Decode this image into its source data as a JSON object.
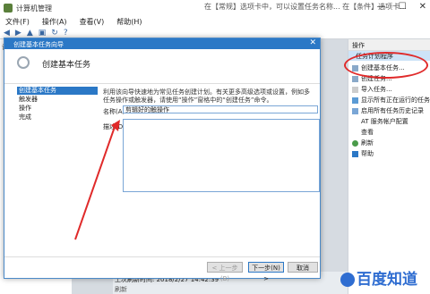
{
  "window": {
    "title": "计算机管理",
    "overlay_text": "在【常规】选项卡中，可以设置任务名称...  在【条件】选项卡..."
  },
  "menubar": [
    "文件(F)",
    "操作(A)",
    "查看(V)",
    "帮助(H)"
  ],
  "toolbar_icons": [
    "back-icon",
    "forward-icon",
    "up-icon",
    "folder-icon",
    "refresh-icon",
    "help-icon"
  ],
  "tree": [
    "计",
    "(",
    "(",
    "(",
    "(",
    "(",
    "(",
    "(",
    "(",
    "(",
    "(",
    "(",
    "(",
    "(",
    "(",
    "(",
    "(",
    "("
  ],
  "actions": {
    "header": "操作",
    "subheader": "任务计划程序",
    "items": [
      {
        "label": "创建基本任务...",
        "icon": "task-icon"
      },
      {
        "label": "创建任务...",
        "icon": "task-icon"
      },
      {
        "label": "导入任务...",
        "icon": "import-icon"
      },
      {
        "label": "显示所有正在运行的任务",
        "icon": "run-icon"
      },
      {
        "label": "启用所有任务历史记录",
        "icon": "history-icon"
      },
      {
        "label": "AT 服务帐户配置",
        "icon": "config-icon"
      },
      {
        "label": "查看",
        "icon": "view-icon"
      },
      {
        "label": "刷新",
        "icon": "refresh-icon"
      },
      {
        "label": "帮助",
        "icon": "help-icon"
      }
    ]
  },
  "status": {
    "last_run_label": "上次刷新时间: 2018/2/27 14:42:39",
    "refresh_label": "刷新"
  },
  "dialog": {
    "title": "创建基本任务向导",
    "heading": "创建基本任务",
    "steps": [
      "创建基本任务",
      "触发器",
      "操作",
      "完成"
    ],
    "description": "利用该向导快速地为常见任务创建计划。有关更多高级选项或设置，例如多任务操作或触发器，请使用“操作”窗格中的“创建任务”命令。",
    "name_label": "名称(A):",
    "name_value": "剪辑好的触操作",
    "desc_label": "描述(D):",
    "buttons": {
      "prev": "< 上一步(B)",
      "next": "下一步(N) >",
      "cancel": "取消"
    }
  },
  "watermark": "百度知道",
  "colors": {
    "accent": "#2b78c6",
    "annotation": "#e02a2a",
    "watermark": "#2f6dd1"
  }
}
